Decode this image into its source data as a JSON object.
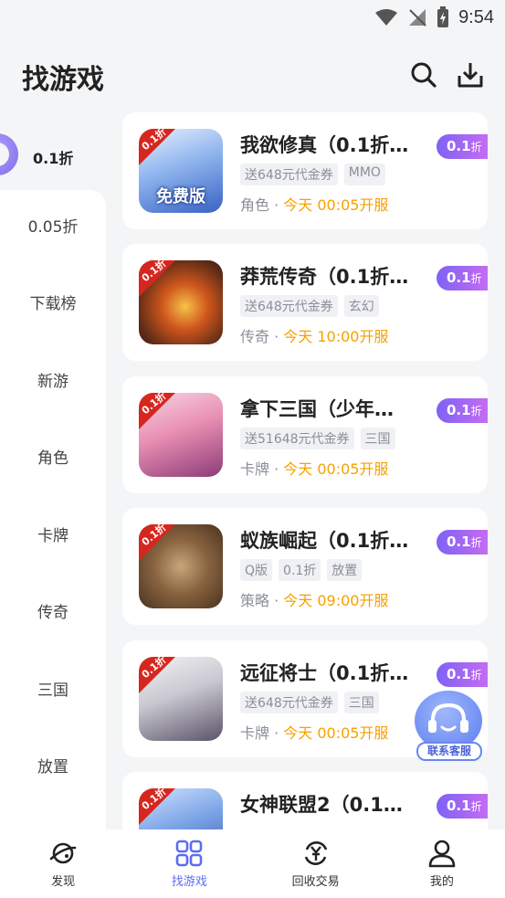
{
  "status_bar": {
    "time": "9:54"
  },
  "header": {
    "title": "找游戏"
  },
  "sidebar": {
    "active": "0.1折",
    "items": [
      "0.05折",
      "下载榜",
      "新游",
      "角色",
      "卡牌",
      "传奇",
      "三国",
      "放置"
    ]
  },
  "games": [
    {
      "title": "我欲修真（0.1折…",
      "tags": [
        "送648元代金券",
        "MMO"
      ],
      "category": "角色",
      "open_time": "今天 00:05开服",
      "discount": "0.1",
      "discount_unit": "折",
      "ribbon": "0.1折",
      "caption": "免费版"
    },
    {
      "title": "莽荒传奇（0.1折…",
      "tags": [
        "送648元代金券",
        "玄幻"
      ],
      "category": "传奇",
      "open_time": "今天 10:00开服",
      "discount": "0.1",
      "discount_unit": "折",
      "ribbon": "0.1折",
      "caption": ""
    },
    {
      "title": "拿下三国（少年…",
      "tags": [
        "送51648元代金券",
        "三国"
      ],
      "category": "卡牌",
      "open_time": "今天 00:05开服",
      "discount": "0.1",
      "discount_unit": "折",
      "ribbon": "0.1折",
      "caption": ""
    },
    {
      "title": "蚁族崛起（0.1折…",
      "tags": [
        "Q版",
        "0.1折",
        "放置"
      ],
      "category": "策略",
      "open_time": "今天 09:00开服",
      "discount": "0.1",
      "discount_unit": "折",
      "ribbon": "0.1折",
      "caption": ""
    },
    {
      "title": "远征将士（0.1折…",
      "tags": [
        "送648元代金券",
        "三国"
      ],
      "category": "卡牌",
      "open_time": "今天 00:05开服",
      "discount": "0.1",
      "discount_unit": "折",
      "ribbon": "0.1折",
      "caption": ""
    },
    {
      "title": "女神联盟2（0.1…",
      "tags": [],
      "category": "",
      "open_time": "",
      "discount": "0.1",
      "discount_unit": "折",
      "ribbon": "0.1折",
      "caption": ""
    }
  ],
  "service": {
    "label": "联系客服"
  },
  "bottom_nav": [
    {
      "label": "发现",
      "icon": "planet-icon"
    },
    {
      "label": "找游戏",
      "icon": "grid-icon"
    },
    {
      "label": "回收交易",
      "icon": "yuan-exchange-icon"
    },
    {
      "label": "我的",
      "icon": "person-icon"
    }
  ],
  "colors": {
    "accent": "#5b6cf5",
    "badge_start": "#7e63f5",
    "badge_end": "#c46cf1",
    "open_time": "#f5a100"
  }
}
